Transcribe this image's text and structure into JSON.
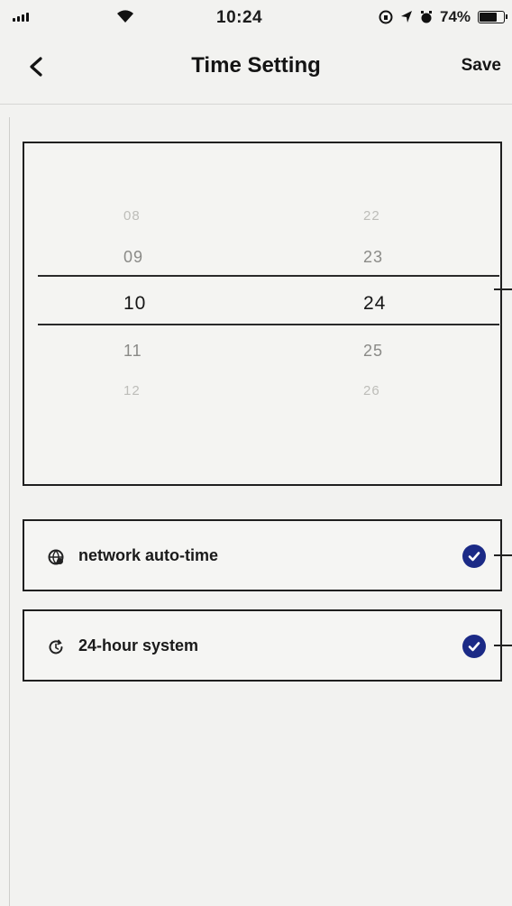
{
  "status_bar": {
    "time": "10:24",
    "battery_percent_text": "74%",
    "battery_level": 0.74,
    "icons": [
      "signal-icon",
      "wifi-icon",
      "lock-rotation-icon",
      "location-icon",
      "alarm-icon",
      "battery-icon"
    ]
  },
  "nav": {
    "back_icon": "chevron-left-icon",
    "title": "Time Setting",
    "save_label": "Save"
  },
  "picker": {
    "hours": [
      "08",
      "09",
      "10",
      "11",
      "12"
    ],
    "minutes": [
      "22",
      "23",
      "24",
      "25",
      "26"
    ],
    "selected_hour": "10",
    "selected_minute": "24"
  },
  "options": [
    {
      "icon": "globe-clock-icon",
      "label": "network auto-time",
      "checked": true
    },
    {
      "icon": "clock-refresh-icon",
      "label": "24-hour system",
      "checked": true
    }
  ],
  "colors": {
    "check_fill": "#1b2a86",
    "background": "#f2f2f0",
    "text": "#1c1c1c"
  }
}
